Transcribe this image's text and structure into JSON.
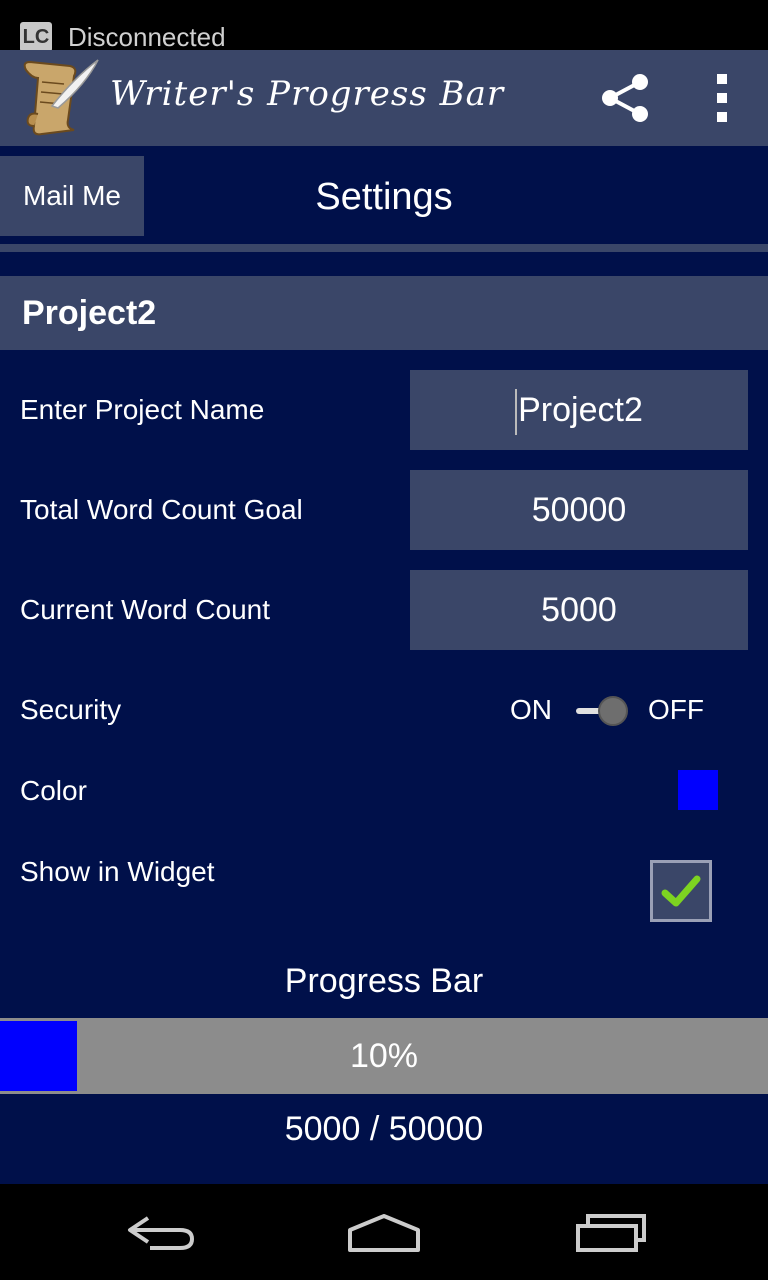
{
  "status_bar": {
    "notification_text": "Disconnected",
    "app_icon_text": "LC"
  },
  "action_bar": {
    "title": "Writer's Progress Bar",
    "share_icon": "share-icon",
    "overflow_icon": "overflow-menu-icon"
  },
  "top_controls": {
    "mail_button_label": "Mail Me",
    "page_title": "Settings"
  },
  "project": {
    "header": "Project2",
    "fields": [
      {
        "label": "Enter Project Name",
        "value": "Project2"
      },
      {
        "label": "Total Word Count Goal",
        "value": "50000"
      },
      {
        "label": "Current Word Count",
        "value": "5000"
      }
    ],
    "security": {
      "label": "Security",
      "on_label": "ON",
      "off_label": "OFF",
      "state": "off"
    },
    "color": {
      "label": "Color",
      "value": "#0000ff"
    },
    "widget": {
      "label": "Show in Widget",
      "checked": true
    }
  },
  "progress": {
    "title": "Progress Bar",
    "fraction": 0.1,
    "percent_label": "10%",
    "count_label": "5000 / 50000",
    "fill_color": "#0000ff"
  },
  "nav_bar": {
    "back_icon": "back-icon",
    "home_icon": "home-icon",
    "recents_icon": "recents-icon"
  }
}
